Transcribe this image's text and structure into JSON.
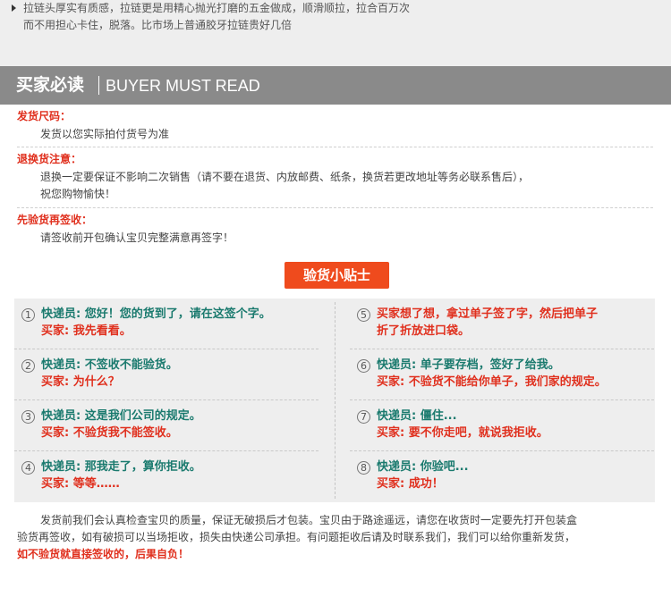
{
  "zipper": {
    "line1": "拉链头厚实有质感，拉链更是用精心抛光打磨的五金做成，顺滑顺拉，拉合百万次",
    "line2": "而不用担心卡住，脱落。比市场上普通胶牙拉链贵好几倍"
  },
  "header": {
    "cn": "买家必读",
    "en": "BUYER MUST READ"
  },
  "notices": [
    {
      "title": "发货尺码：",
      "lines": [
        "发货以您实际拍付货号为准"
      ]
    },
    {
      "title": "退换货注意：",
      "lines": [
        "退换一定要保证不影响二次销售（请不要在退货、内放邮费、纸条，换货若更改地址等务必联系售后），",
        "祝您购物愉快！"
      ]
    },
    {
      "title": "先验货再签收：",
      "lines": [
        "请签收前开包确认宝贝完整满意再签字！"
      ]
    }
  ],
  "tip": {
    "label": "验货小贴士"
  },
  "dialogs": [
    {
      "num": "1",
      "q": "快递员: 您好！您的货到了，请在这签个字。",
      "a": "买家: 我先看看。"
    },
    {
      "num": "2",
      "q": "快递员: 不签收不能验货。",
      "a": "买家: 为什么？"
    },
    {
      "num": "3",
      "q": "快递员: 这是我们公司的规定。",
      "a": "买家: 不验货我不能签收。"
    },
    {
      "num": "4",
      "q": "快递员: 那我走了，算你拒收。",
      "a": "买家: 等等……"
    },
    {
      "num": "5",
      "q": "买家想了想，拿过单子签了字，然后把单子",
      "a": "折了折放进口袋。",
      "qRed": true
    },
    {
      "num": "6",
      "q": "快递员: 单子要存档，签好了给我。",
      "a": "买家: 不验货不能给你单子，我们家的规定。"
    },
    {
      "num": "7",
      "q": "快递员: 僵住...",
      "a": "买家: 要不你走吧，就说我拒收。"
    },
    {
      "num": "8",
      "q": "快递员: 你验吧...",
      "a": "买家: 成功！"
    }
  ],
  "footer": {
    "p1": "发货前我们会认真检查宝贝的质量，保证无破损后才包装。宝贝由于路途遥远，请您在收货时一定要先打开包装盒",
    "p2": "验货再签收，如有破损可以当场拒收，损失由快递公司承担。有问题拒收后请及时联系我们，我们可以给你重新发货，",
    "p3": "如不验货就直接签收的，后果自负！"
  },
  "colors": {
    "accent": "#e0301e",
    "header_bg": "#8a8a8a",
    "tip_bg": "#ef4b1d",
    "question": "#1a7a6e"
  }
}
